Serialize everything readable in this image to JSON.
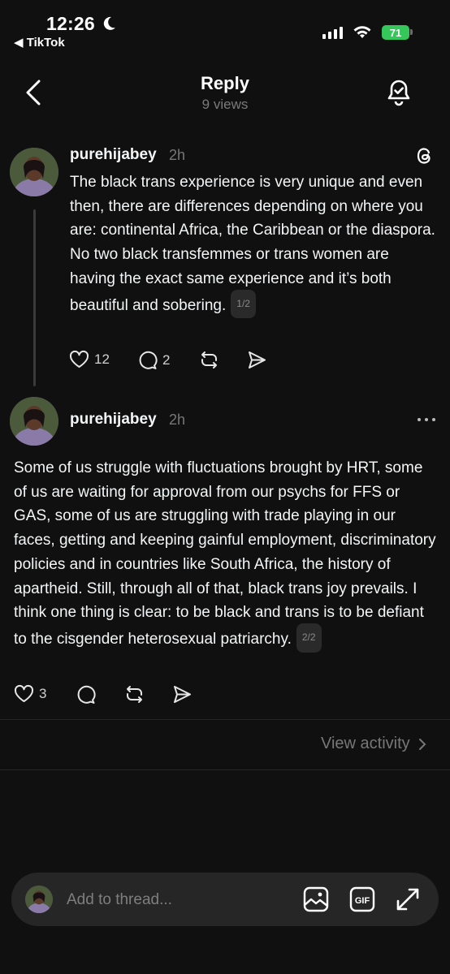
{
  "status_bar": {
    "time": "12:26",
    "back_app": "◀ TikTok",
    "battery": "71"
  },
  "nav": {
    "title": "Reply",
    "views": "9 views"
  },
  "posts": [
    {
      "username": "purehijabey",
      "time": "2h",
      "text": "The black trans experience is very unique and even then, there are differences depending on where you are: continental Africa, the Caribbean or the diaspora. No two black transfemmes or trans women are having the exact same experience and it’s both beautiful and sobering.",
      "page_badge": "1/2",
      "likes": "12",
      "replies": "2"
    },
    {
      "username": "purehijabey",
      "time": "2h",
      "text": "Some of us struggle with fluctuations brought by HRT, some of us are waiting for approval from our psychs for FFS or GAS, some of us are struggling with trade playing in our faces, getting and keeping gainful employment, discriminatory policies and in countries like South Africa, the history of apartheid. Still, through all of that, black trans joy prevails. I think one thing is clear: to be black and trans is to be defiant to the cisgender heterosexual patriarchy.",
      "page_badge": "2/2",
      "likes": "3"
    }
  ],
  "view_activity": "View activity",
  "composer": {
    "placeholder": "Add to thread..."
  },
  "icons": [
    "moon-icon",
    "signal-icon",
    "wifi-icon",
    "back-chevron-icon",
    "bell-check-icon",
    "threads-logo-icon",
    "heart-icon",
    "comment-icon",
    "repost-icon",
    "share-icon",
    "more-icon",
    "chevron-right-icon",
    "image-icon",
    "gif-icon",
    "expand-icon"
  ]
}
